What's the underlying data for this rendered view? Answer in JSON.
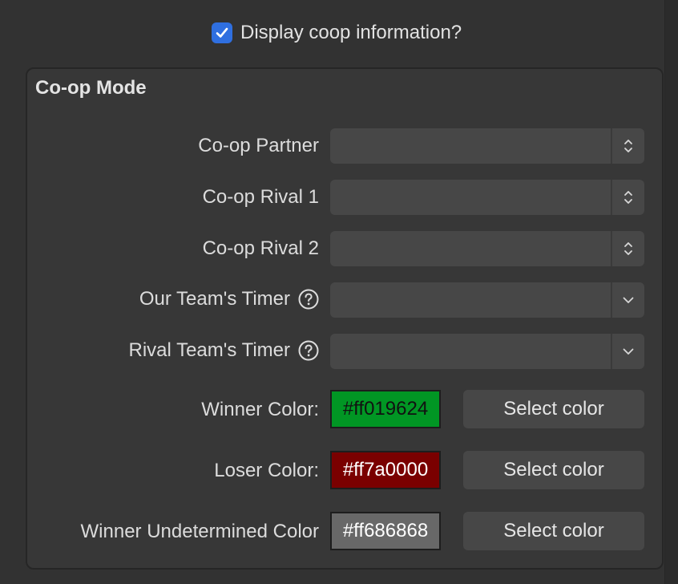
{
  "header": {
    "checkbox_label": "Display coop information?",
    "checkbox_checked": true
  },
  "group": {
    "title": "Co-op Mode",
    "fields": [
      {
        "label": "Co-op Partner",
        "control": "stepper-combo",
        "value": "",
        "help": false
      },
      {
        "label": "Co-op Rival 1",
        "control": "stepper-combo",
        "value": "",
        "help": false
      },
      {
        "label": "Co-op Rival 2",
        "control": "stepper-combo",
        "value": "",
        "help": false
      },
      {
        "label": "Our Team's Timer",
        "control": "dropdown",
        "value": "",
        "help": true
      },
      {
        "label": "Rival Team's Timer",
        "control": "dropdown",
        "value": "",
        "help": true
      }
    ],
    "colors": [
      {
        "label": "Winner Color:",
        "value": "#ff019624",
        "swatch": "#019624",
        "text_color": "#111111",
        "button": "Select color"
      },
      {
        "label": "Loser Color:",
        "value": "#ff7a0000",
        "swatch": "#7a0000",
        "text_color": "#ffffff",
        "button": "Select color"
      },
      {
        "label": "Winner Undetermined Color",
        "value": "#ff686868",
        "swatch": "#686868",
        "text_color": "#ffffff",
        "button": "Select color"
      }
    ]
  },
  "icons": {
    "checkmark": "checkmark-icon",
    "stepper": "up-down-chevron-icon",
    "dropdown": "chevron-down-icon",
    "help": "question-mark-circle-icon"
  },
  "colors": {
    "background": "#323232",
    "panel": "#373737",
    "control": "#474747",
    "accent": "#2f6fe0"
  }
}
